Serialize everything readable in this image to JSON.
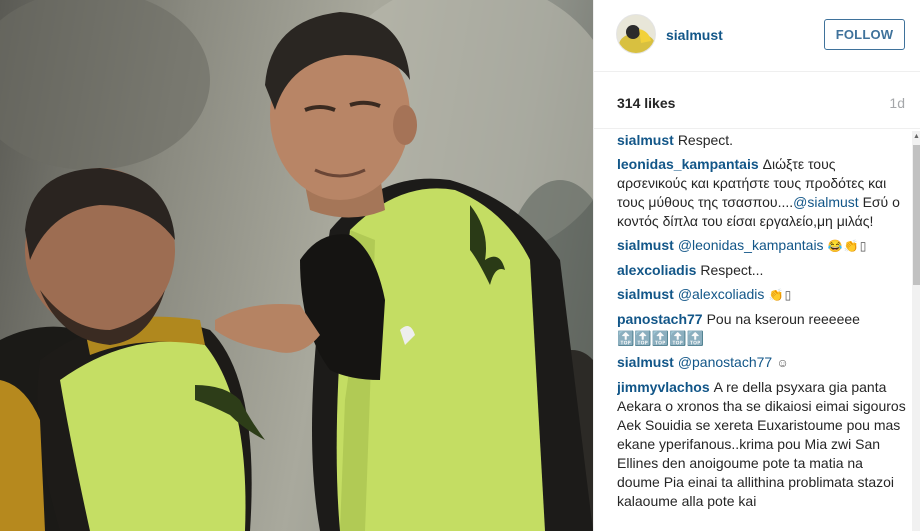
{
  "post": {
    "username": "sialmust",
    "follow_label": "FOLLOW",
    "likes": "314 likes",
    "time": "1d"
  },
  "comments": [
    {
      "author": "sialmust",
      "text": "Respect.",
      "mention": "",
      "suffix": ""
    },
    {
      "author": "leonidas_kampantais",
      "text": "Διώξτε τους αρσενικούς και κρατήστε τους προδότες και τους μύθους της τσασπου....",
      "mention": "@sialmust",
      "suffix": " Εσύ ο κοντός δίπλα του είσαι εργαλείο,μη μιλάς!"
    },
    {
      "author": "sialmust",
      "text": "",
      "mention": "@leonidas_kampantais",
      "suffix": " 😂👏▯"
    },
    {
      "author": "alexcoliadis",
      "text": "Respect...",
      "mention": "",
      "suffix": ""
    },
    {
      "author": "sialmust",
      "text": "",
      "mention": "@alexcoliadis",
      "suffix": " 👏▯"
    },
    {
      "author": "panostach77",
      "text": "Pou na kseroun reeeeee 🔝🔝🔝🔝🔝",
      "mention": "",
      "suffix": ""
    },
    {
      "author": "sialmust",
      "text": "",
      "mention": "@panostach77",
      "suffix": " ☺"
    },
    {
      "author": "jimmyvlachos",
      "text": "A re della psyxara gia panta Aekara o xronos tha se dikaiosi eimai sigouros Aek Souidia se xereta Euxaristoume pou mas ekane yperifanous..krima pou Mia zwi San Ellines den anoigoume pote ta matia na doume Pia einai ta allithina problimata stazoi kalaoume alla pote kai",
      "mention": "",
      "suffix": ""
    }
  ],
  "icons": {
    "avatar": "profile-avatar",
    "scroll_up": "scroll-up-arrow"
  },
  "colors": {
    "link": "#125688",
    "follow": "#3f729b",
    "bib": "#c8e26a"
  }
}
